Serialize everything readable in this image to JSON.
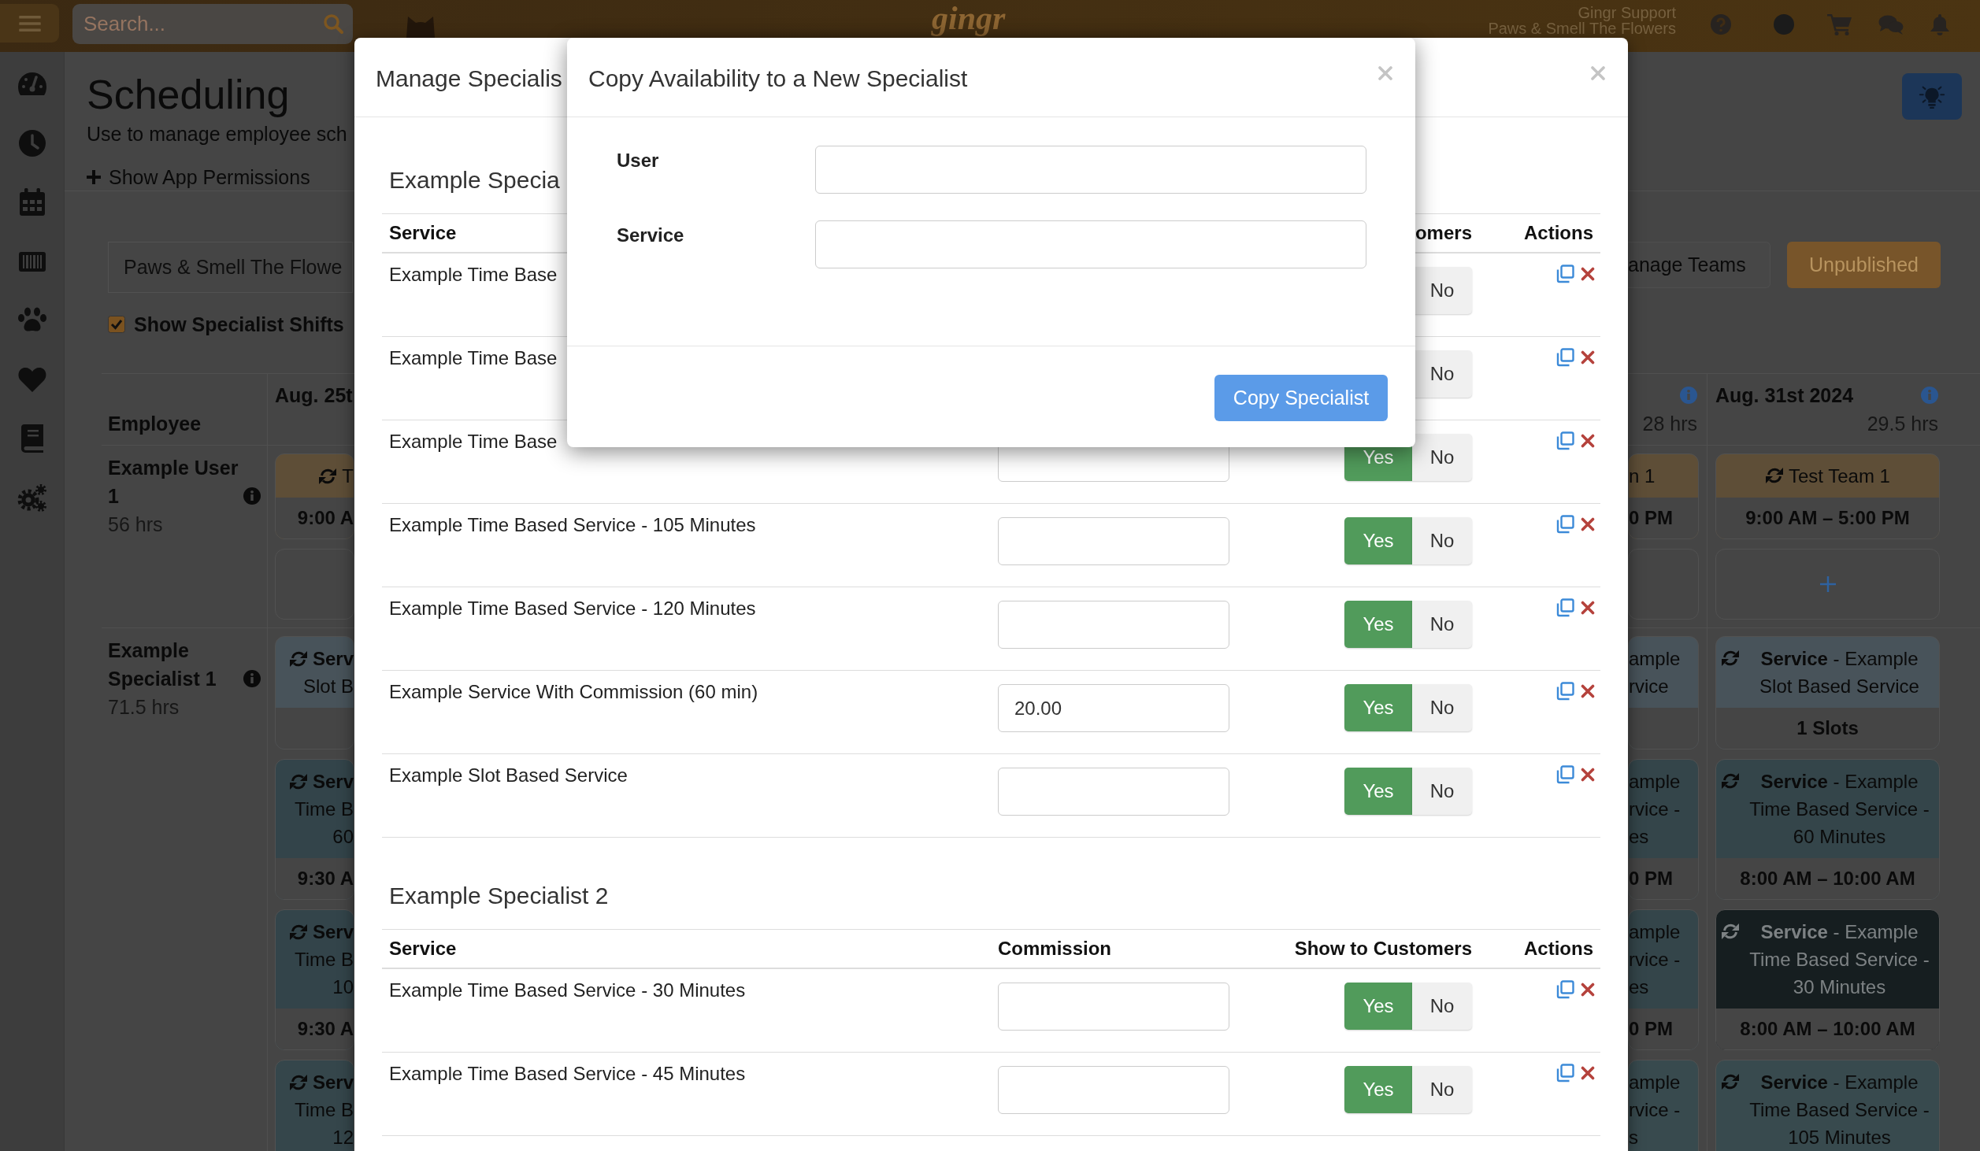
{
  "top_bar": {
    "search": {
      "placeholder": "Search..."
    },
    "logo": "gingr",
    "account": {
      "name": "Gingr Support",
      "location": "Paws & Smell The Flowers"
    }
  },
  "page": {
    "title": "Scheduling",
    "subtitle": "Use to manage employee sch",
    "permissions_link": "Show App Permissions",
    "location_select": "Paws & Smell The Flowe",
    "show_specialist_shifts": {
      "label": "Show Specialist Shifts",
      "checked": true
    },
    "manage_teams_button": "anage Teams",
    "publish_button": "Unpublished"
  },
  "schedule": {
    "employee_header": "Employee",
    "days": [
      {
        "kind": "start",
        "date": "Aug. 25t"
      },
      {
        "kind": "end",
        "hours": "28 hrs"
      },
      {
        "kind": "full",
        "date": "Aug. 31st 2024",
        "hours": "29.5 hrs"
      }
    ],
    "rows": [
      {
        "name": "Example User 1",
        "hours": "56 hrs",
        "cells": [
          [
            {
              "kind": "team",
              "color": "#5e4e37",
              "lines": [
                "T"
              ],
              "time": "9:00 A"
            },
            {
              "kind": "add"
            }
          ],
          [
            {
              "kind": "team",
              "color": "#5e4e37",
              "lines": [
                "n 1"
              ],
              "time": "0 PM"
            },
            {
              "kind": "add"
            }
          ],
          [
            {
              "kind": "team",
              "color": "#5e4e37",
              "title": "Test Team 1",
              "time": "9:00 AM – 5:00 PM"
            },
            {
              "kind": "add"
            }
          ]
        ]
      },
      {
        "name": "Example Specialist 1",
        "hours": "71.5 hrs",
        "cells": [
          [
            {
              "kind": "service",
              "color": "#48535a",
              "lines": [
                "Serv",
                "Slot B"
              ]
            },
            {
              "kind": "service",
              "color": "#33444a",
              "lines": [
                "Serv",
                "Time B",
                "60"
              ],
              "time": "9:30 A"
            },
            {
              "kind": "service",
              "color": "#33444a",
              "lines": [
                "Serv",
                "Time B",
                "10"
              ],
              "time": "9:30 A"
            },
            {
              "kind": "service",
              "color": "#35464b",
              "lines": [
                "Serv",
                "Time B",
                "12"
              ]
            }
          ],
          [
            {
              "kind": "service",
              "color": "#48535a",
              "lines": [
                "ample",
                "rvice"
              ]
            },
            {
              "kind": "service",
              "color": "#34454a",
              "lines": [
                "ample",
                "rvice -",
                "es"
              ],
              "time": "0 PM"
            },
            {
              "kind": "service",
              "color": "#34454a",
              "lines": [
                "ample",
                "rvice -",
                "es"
              ],
              "time": "0 PM"
            },
            {
              "kind": "service",
              "color": "#384a4e",
              "lines": [
                "ample",
                "rvice -",
                "s"
              ]
            }
          ],
          [
            {
              "kind": "service",
              "color": "#48535a",
              "title": "**Service** - Example Slot Based Service",
              "time": "1 Slots"
            },
            {
              "kind": "service",
              "color": "#34454a",
              "title": "**Service** - Example Time Based Service - 60 Minutes",
              "time": "8:00 AM – 10:00 AM"
            },
            {
              "kind": "service",
              "color": "#161e20",
              "title": "**Service** - Example Time Based Service - 30 Minutes",
              "time": "8:00 AM – 10:00 AM"
            },
            {
              "kind": "service",
              "color": "#384a4e",
              "title": "**Service** - Example Time Based Service - 105 Minutes"
            }
          ]
        ]
      }
    ]
  },
  "manage_specialists_modal": {
    "title": "Manage Specialis",
    "sections": [
      {
        "heading": "Example Specia",
        "columns": {
          "service": "Service",
          "show": "omers",
          "actions": "Actions"
        },
        "rows": [
          {
            "kind": "covered",
            "service": "Example Time Base",
            "toggle": [
              {
                "label": "No",
                "selected": false
              }
            ]
          },
          {
            "kind": "covered",
            "service": "Example Time Base",
            "toggle": [
              {
                "label": "No",
                "selected": false
              }
            ]
          },
          {
            "kind": "full",
            "service": "Example Time Base",
            "toggle": [
              {
                "label": "Yes",
                "selected": true
              },
              {
                "label": "No",
                "selected": false
              }
            ]
          },
          {
            "kind": "full",
            "service": "Example Time Based Service - 105 Minutes",
            "toggle": [
              {
                "label": "Yes",
                "selected": true
              },
              {
                "label": "No",
                "selected": false
              }
            ]
          },
          {
            "kind": "full",
            "service": "Example Time Based Service - 120 Minutes",
            "toggle": [
              {
                "label": "Yes",
                "selected": true
              },
              {
                "label": "No",
                "selected": false
              }
            ]
          },
          {
            "kind": "full",
            "service": "Example Service With Commission (60 min)",
            "commission": "20.00",
            "toggle": [
              {
                "label": "Yes",
                "selected": true
              },
              {
                "label": "No",
                "selected": false
              }
            ]
          },
          {
            "kind": "full",
            "service": "Example Slot Based Service",
            "toggle": [
              {
                "label": "Yes",
                "selected": true
              },
              {
                "label": "No",
                "selected": false
              }
            ]
          }
        ]
      },
      {
        "heading": "Example Specialist 2",
        "columns": {
          "service": "Service",
          "commission": "Commission",
          "show": "Show to Customers",
          "actions": "Actions"
        },
        "rows": [
          {
            "kind": "full",
            "service": "Example Time Based Service - 30 Minutes",
            "toggle": [
              {
                "label": "Yes",
                "selected": true
              },
              {
                "label": "No",
                "selected": false
              }
            ]
          },
          {
            "kind": "full",
            "service": "Example Time Based Service - 45 Minutes",
            "toggle": [
              {
                "label": "Yes",
                "selected": true
              },
              {
                "label": "No",
                "selected": false
              }
            ]
          }
        ]
      }
    ]
  },
  "copy_modal": {
    "title": "Copy Availability to a New Specialist",
    "fields": [
      {
        "label": "User"
      },
      {
        "label": "Service"
      }
    ],
    "submit": "Copy Specialist"
  }
}
